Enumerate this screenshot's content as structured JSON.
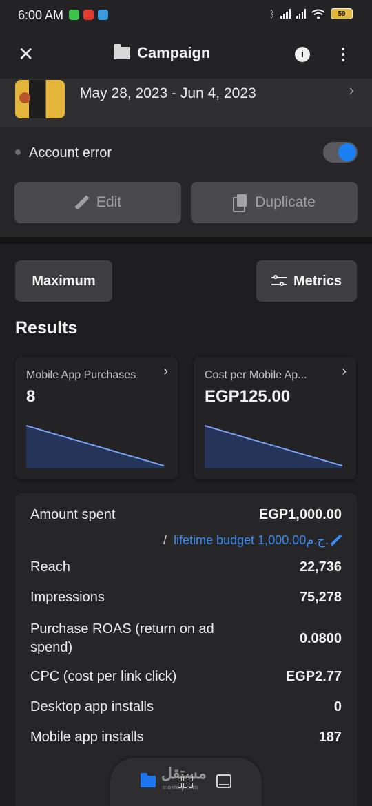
{
  "status_bar": {
    "time": "6:00 AM",
    "battery": "59",
    "app_icon_colors": [
      "#3cc44a",
      "#e03a2f",
      "#3b9be0"
    ]
  },
  "header": {
    "title": "Campaign",
    "info_icon": "i"
  },
  "campaign": {
    "date_range": "May 28, 2023 - Jun 4, 2023"
  },
  "status": {
    "label": "Account error",
    "toggle_on": true
  },
  "actions": {
    "edit_label": "Edit",
    "duplicate_label": "Duplicate"
  },
  "filters": {
    "maximum_label": "Maximum",
    "metrics_label": "Metrics"
  },
  "results": {
    "title": "Results",
    "cards": [
      {
        "label": "Mobile App Purchases",
        "value": "8"
      },
      {
        "label": "Cost per Mobile Ap...",
        "value": "EGP125.00"
      }
    ]
  },
  "chart_data": [
    {
      "type": "area",
      "x": [
        0,
        1
      ],
      "values": [
        1,
        0
      ],
      "color": "#7aa2f7",
      "fill": "#25355a"
    },
    {
      "type": "area",
      "x": [
        0,
        1
      ],
      "values": [
        1,
        0
      ],
      "color": "#7aa2f7",
      "fill": "#25355a"
    }
  ],
  "stats": {
    "amount_spent": {
      "label": "Amount spent",
      "value": "EGP1,000.00"
    },
    "budget": {
      "slash": "/",
      "text": "lifetime budget 1,000.00ج.م."
    },
    "rows": [
      {
        "label": "Reach",
        "value": "22,736"
      },
      {
        "label": "Impressions",
        "value": "75,278"
      },
      {
        "label": "Purchase ROAS (return on ad spend)",
        "value": "0.0800"
      },
      {
        "label": "CPC (cost per link click)",
        "value": "EGP2.77"
      },
      {
        "label": "Desktop app installs",
        "value": "0"
      },
      {
        "label": "Mobile app installs",
        "value": "187"
      }
    ]
  },
  "bottom_bar": {
    "watermark": "مستقل",
    "watermark_sub": "mostaql.com"
  },
  "colors": {
    "accent": "#1a7ff0",
    "link": "#3c8bf0"
  }
}
